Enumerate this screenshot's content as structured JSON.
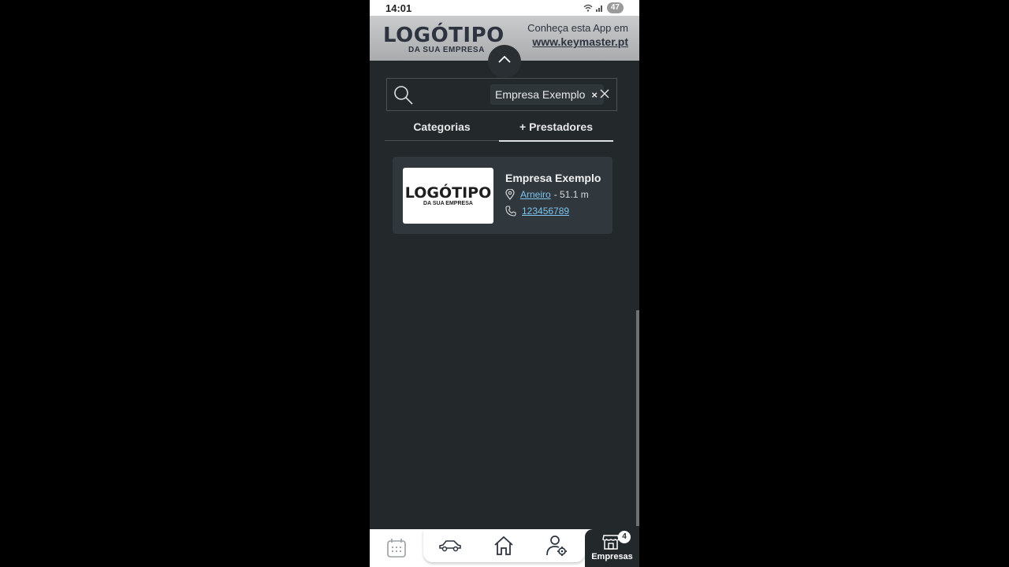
{
  "statusbar": {
    "time": "14:01",
    "battery": "47"
  },
  "header": {
    "logo_main": "LOGÓTIPO",
    "logo_sub": "DA SUA EMPRESA",
    "promo_line1": "Conheça esta App em",
    "promo_link": "www.keymaster.pt"
  },
  "search": {
    "chip_label": "Empresa Exemplo",
    "chip_remove": "×"
  },
  "tabs": [
    {
      "label": "Categorias"
    },
    {
      "label": "+ Prestadores"
    }
  ],
  "result": {
    "logo_main": "LOGÓTIPO",
    "logo_sub": "DA SUA EMPRESA",
    "title": "Empresa Exemplo",
    "location": "Arneiro",
    "distance": "- 51.1 m",
    "phone": "123456789"
  },
  "bottomnav": {
    "active_label": "Empresas",
    "badge_count": "4",
    "items": [
      "calendar-icon",
      "car-icon",
      "home-icon",
      "user-settings-icon",
      "store-icon"
    ]
  },
  "colors": {
    "background": "#23282b",
    "card": "#31383d",
    "link": "#7cc4ee",
    "header": "#bfc1c3"
  }
}
